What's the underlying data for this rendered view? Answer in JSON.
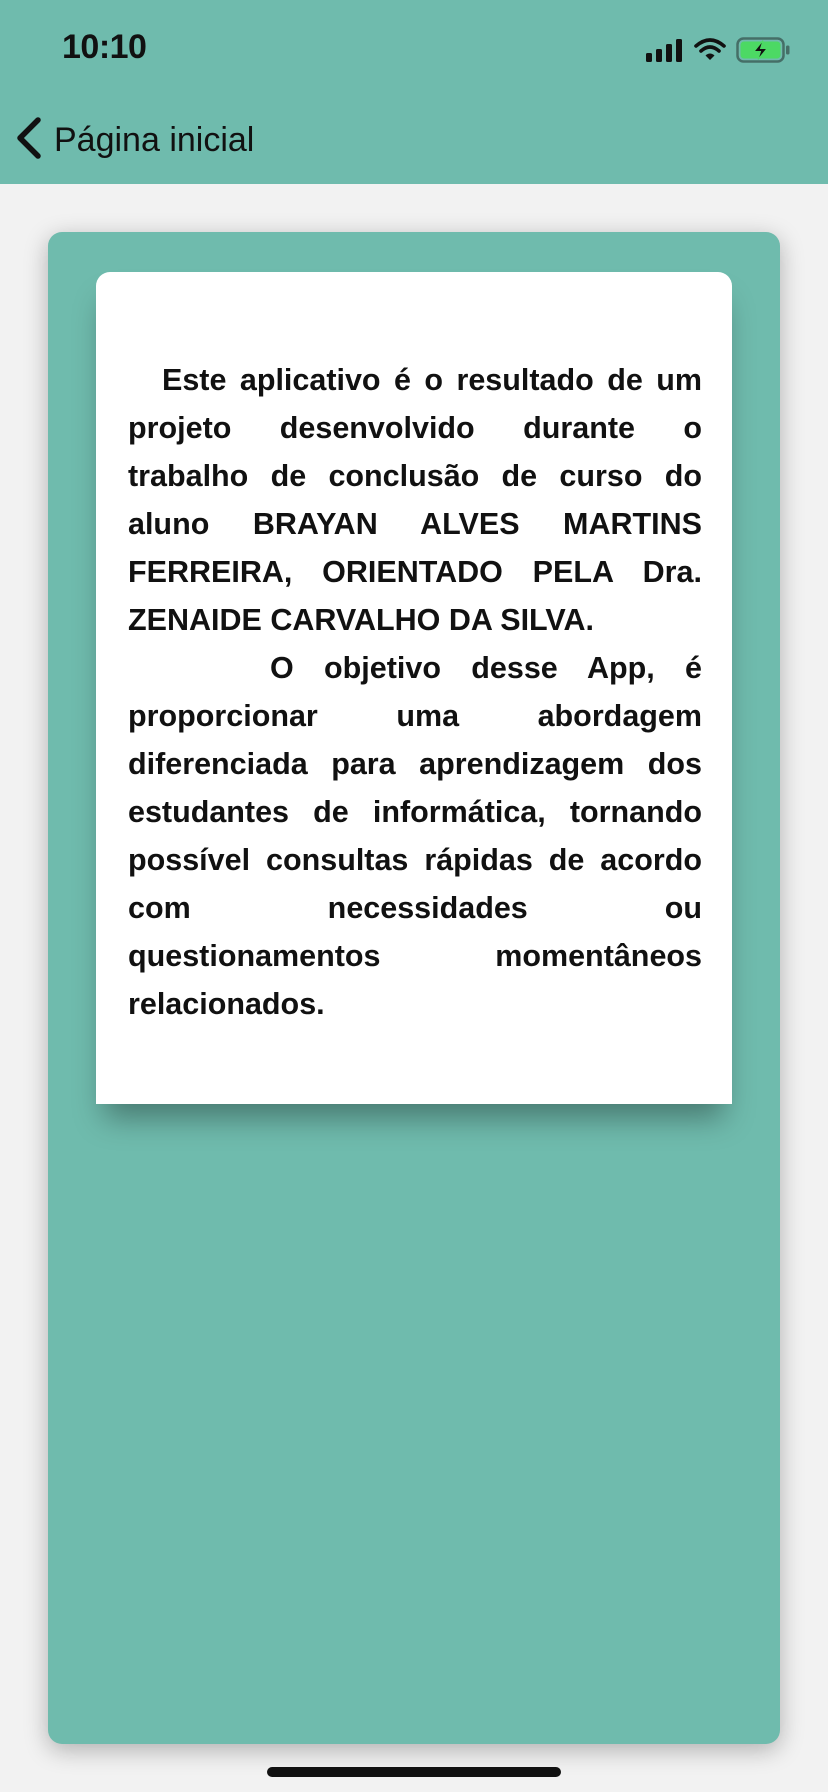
{
  "status_bar": {
    "time": "10:10",
    "icons": [
      "signal-icon",
      "wifi-icon",
      "battery-charging-icon"
    ]
  },
  "nav": {
    "back_label": "Página inicial",
    "icon": "chevron-left-icon"
  },
  "content": {
    "paragraph_1": "Este aplicativo é o resultado de um projeto desenvolvido durante o trabalho de conclusão de curso do aluno BRAYAN ALVES MARTINS FERREIRA, ORIENTADO PELA Dra. ZENAIDE CARVALHO DA SILVA.",
    "paragraph_2": "O objetivo desse App, é proporcionar uma abordagem diferenciada para aprendizagem dos estudantes de informática, tornando possível consultas rápidas de acordo com necessidades ou questionamentos momentâneos relacionados."
  },
  "colors": {
    "accent": "#6fbbad",
    "background": "#f2f2f2",
    "card": "#ffffff",
    "battery": "#4cd964"
  }
}
